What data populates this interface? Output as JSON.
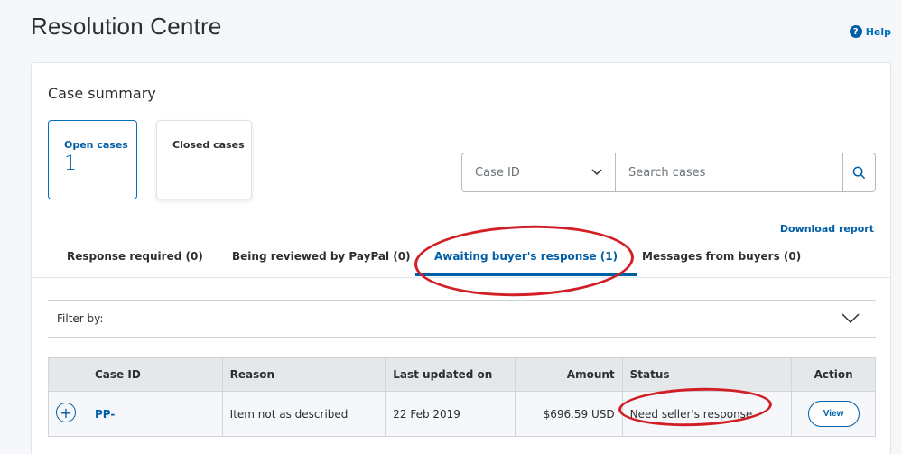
{
  "page": {
    "title": "Resolution Centre",
    "help_label": "Help",
    "help_icon": "?"
  },
  "summary": {
    "title": "Case summary",
    "open_label": "Open cases",
    "open_count": "1",
    "closed_label": "Closed cases"
  },
  "search": {
    "select_value": "Case ID",
    "placeholder": "Search cases"
  },
  "download_label": "Download report",
  "tabs": [
    {
      "label": "Response required (0)"
    },
    {
      "label": "Being reviewed by PayPal (0)"
    },
    {
      "label": "Awaiting buyer's response (1)"
    },
    {
      "label": "Messages from buyers (0)"
    }
  ],
  "filter_label": "Filter by:",
  "table": {
    "headers": [
      "Case ID",
      "Reason",
      "Last updated on",
      "Amount",
      "Status",
      "Action"
    ],
    "rows": [
      {
        "case_id": "PP-",
        "reason": "Item not as described",
        "updated": "22 Feb 2019",
        "amount": "$696.59 USD",
        "status": "Need seller's response",
        "action": "View"
      }
    ]
  },
  "colors": {
    "accent": "#005ea6",
    "annotation": "#d21f26"
  }
}
